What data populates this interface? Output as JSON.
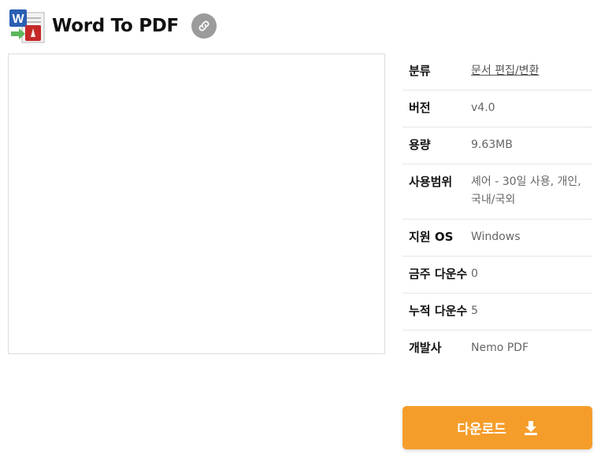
{
  "app": {
    "title": "Word To PDF"
  },
  "info": {
    "rows": [
      {
        "label": "분류",
        "value": "문서 편집/변환"
      },
      {
        "label": "버전",
        "value": "v4.0"
      },
      {
        "label": "용량",
        "value": "9.63MB"
      },
      {
        "label": "사용범위",
        "value": "셰어 - 30일 사용, 개인, 국내/국외"
      },
      {
        "label": "지원 OS",
        "value": "Windows"
      },
      {
        "label": "금주 다운수",
        "value": "0"
      },
      {
        "label": "누적 다운수",
        "value": "5"
      },
      {
        "label": "개발사",
        "value": "Nemo PDF"
      }
    ]
  },
  "download": {
    "label": "다운로드"
  },
  "colors": {
    "accent": "#f59d2a",
    "link_button": "#9b9b9b"
  },
  "icons": {
    "app": "word-to-pdf-icon",
    "link": "link-icon",
    "download": "download-icon"
  }
}
